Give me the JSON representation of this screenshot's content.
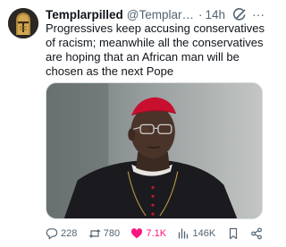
{
  "tweet": {
    "display_name": "Templarpilled",
    "handle": "@Templarpi...",
    "separator": "·",
    "time": "14h",
    "text": "Progressives keep accusing conservatives of racism; meanwhile all the conservatives are hoping that an African man will be chosen as the next Pope"
  },
  "icons": {
    "avatar": "knight-helmet-avatar",
    "grok": "grok-icon",
    "more": "more-icon",
    "reply": "reply-icon",
    "retweet": "retweet-icon",
    "like": "heart-icon",
    "views": "views-icon",
    "bookmark": "bookmark-icon",
    "share": "share-icon"
  },
  "more_glyph": "···",
  "actions": {
    "replies": "228",
    "retweets": "780",
    "likes": "7.1K",
    "views": "146K"
  },
  "colors": {
    "text": "#0f1419",
    "secondary": "#536471",
    "like": "#f91880",
    "accent": "#1d9bf0"
  }
}
